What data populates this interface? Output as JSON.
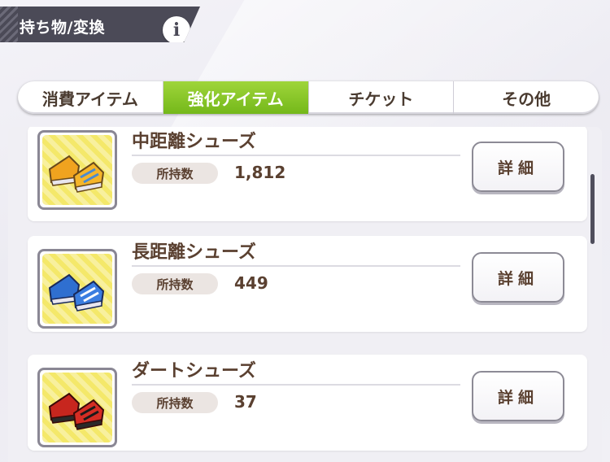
{
  "header": {
    "title": "持ち物/変換",
    "info_label": "i"
  },
  "tabs": [
    {
      "label": "消費アイテム",
      "active": false
    },
    {
      "label": "強化アイテム",
      "active": true
    },
    {
      "label": "チケット",
      "active": false
    },
    {
      "label": "その他",
      "active": false
    }
  ],
  "colors": {
    "active_tab": "#86c72a",
    "header_bg": "#4b4a57",
    "text_brown": "#5a4030"
  },
  "items": [
    {
      "name": "中距離シューズ",
      "qty_label": "所持数",
      "qty": "1,812",
      "detail_label": "詳細",
      "icon": "yellow-shoes-icon"
    },
    {
      "name": "長距離シューズ",
      "qty_label": "所持数",
      "qty": "449",
      "detail_label": "詳細",
      "icon": "blue-shoes-icon"
    },
    {
      "name": "ダートシューズ",
      "qty_label": "所持数",
      "qty": "37",
      "detail_label": "詳細",
      "icon": "red-shoes-icon"
    }
  ]
}
